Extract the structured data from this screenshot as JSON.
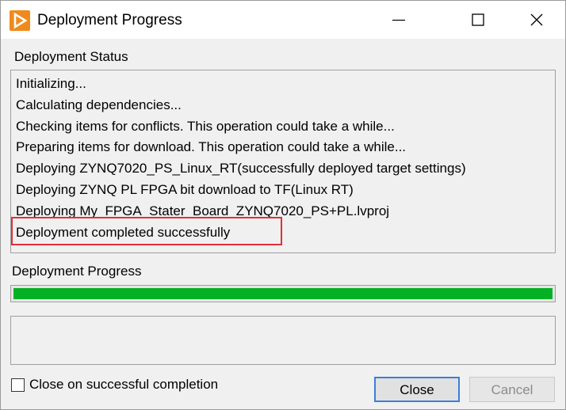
{
  "window": {
    "title": "Deployment Progress"
  },
  "status": {
    "label": "Deployment Status",
    "lines": [
      "Initializing...",
      "Calculating dependencies...",
      "Checking items for conflicts. This operation could take a while...",
      "Preparing items for download. This operation could take a while...",
      "Deploying ZYNQ7020_PS_Linux_RT(successfully deployed target settings)",
      "Deploying ZYNQ PL FPGA bit download to TF(Linux RT)",
      "Deploying My_FPGA_Stater_Board_ZYNQ7020_PS+PL.lvproj",
      "Deployment completed successfully"
    ]
  },
  "progress": {
    "label": "Deployment Progress",
    "percent": 100,
    "fill_color": "#06b025"
  },
  "options": {
    "close_on_success_label": "Close on successful completion",
    "close_on_success_checked": false
  },
  "buttons": {
    "close_label": "Close",
    "cancel_label": "Cancel"
  },
  "colors": {
    "highlight": "#e0303a",
    "accent": "#3c7fd6",
    "app_icon": "#f08a1c"
  }
}
